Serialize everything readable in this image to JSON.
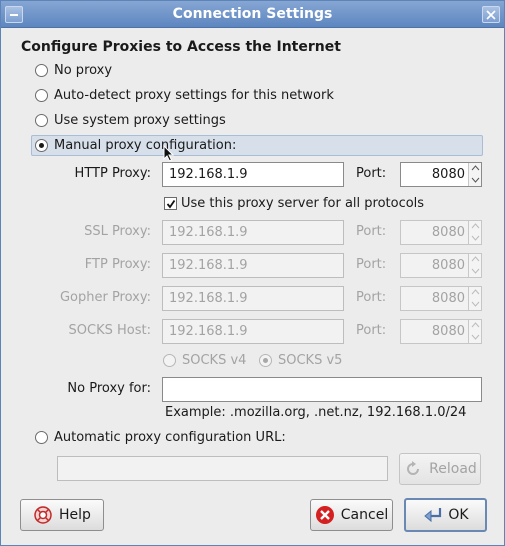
{
  "window": {
    "title": "Connection Settings"
  },
  "heading": "Configure Proxies to Access the Internet",
  "options": {
    "no_proxy": "No proxy",
    "auto_detect": "Auto-detect proxy settings for this network",
    "system": "Use system proxy settings",
    "manual": "Manual proxy configuration:",
    "pac": "Automatic proxy configuration URL:"
  },
  "selected_option": "manual",
  "http": {
    "label": "HTTP Proxy:",
    "value": "192.168.1.9",
    "port_label": "Port:",
    "port": "8080"
  },
  "use_for_all": {
    "label": "Use this proxy server for all protocols",
    "checked": true
  },
  "ssl": {
    "label": "SSL Proxy:",
    "value": "192.168.1.9",
    "port_label": "Port:",
    "port": "8080"
  },
  "ftp": {
    "label": "FTP Proxy:",
    "value": "192.168.1.9",
    "port_label": "Port:",
    "port": "8080"
  },
  "gopher": {
    "label": "Gopher Proxy:",
    "value": "192.168.1.9",
    "port_label": "Port:",
    "port": "8080"
  },
  "socks": {
    "label": "SOCKS Host:",
    "value": "192.168.1.9",
    "port_label": "Port:",
    "port": "8080"
  },
  "socks_version": {
    "v4": "SOCKS v4",
    "v5": "SOCKS v5",
    "selected": "v5"
  },
  "no_proxy_for": {
    "label": "No Proxy for:",
    "value": ""
  },
  "example": "Example: .mozilla.org, .net.nz, 192.168.1.0/24",
  "pac_url": {
    "value": ""
  },
  "buttons": {
    "reload": "Reload",
    "help": "Help",
    "cancel": "Cancel",
    "ok": "OK"
  },
  "icons": {
    "window_menu": "window-menu-icon",
    "close": "close-icon",
    "reload": "reload-icon",
    "help": "help-icon",
    "cancel": "cancel-icon",
    "ok": "ok-icon",
    "cursor": "mouse-cursor-icon"
  },
  "colors": {
    "titlebar": "#6b91c8",
    "highlight": "#d6dfea",
    "cancel_red": "#d42020"
  }
}
